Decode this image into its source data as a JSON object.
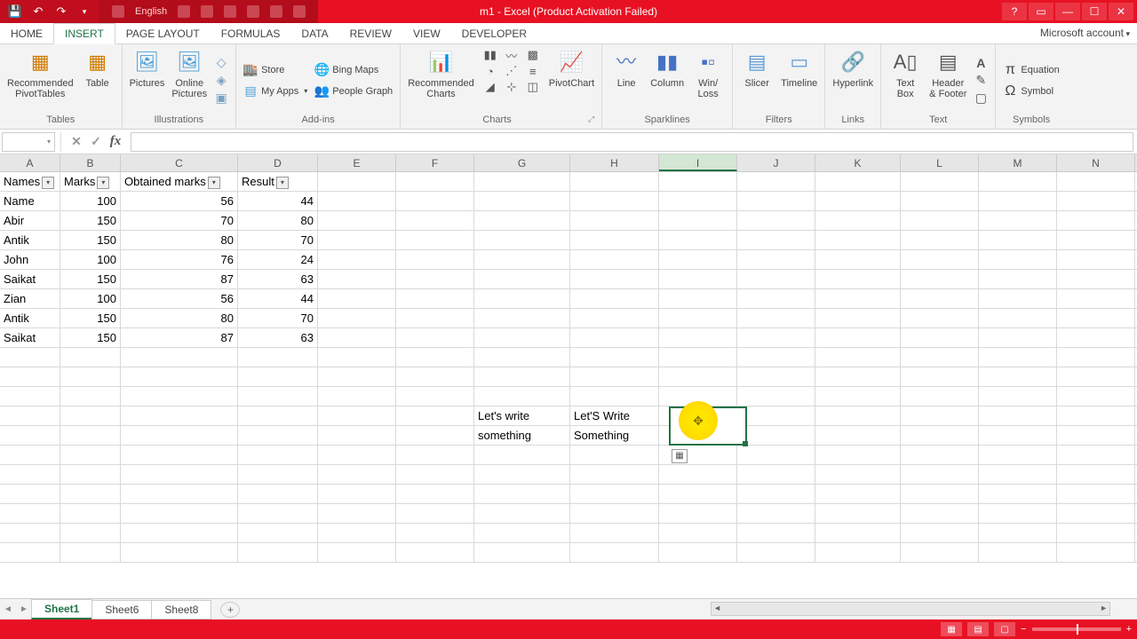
{
  "title": "m1 - Excel (Product Activation Failed)",
  "language": "English",
  "account_label": "Microsoft account",
  "tabs": {
    "home": "HOME",
    "insert": "INSERT",
    "page_layout": "PAGE LAYOUT",
    "formulas": "FORMULAS",
    "data": "DATA",
    "review": "REVIEW",
    "view": "VIEW",
    "developer": "DEVELOPER"
  },
  "ribbon": {
    "tables": {
      "label": "Tables",
      "table": "Table",
      "pivot": "Recommended\nPivotTables"
    },
    "illustrations": {
      "label": "Illustrations",
      "pictures": "Pictures",
      "online": "Online\nPictures"
    },
    "addins": {
      "label": "Add-ins",
      "store": "Store",
      "bing": "Bing Maps",
      "myapps": "My Apps",
      "people": "People Graph"
    },
    "charts": {
      "label": "Charts",
      "rec": "Recommended\nCharts",
      "pivotchart": "PivotChart"
    },
    "sparklines": {
      "label": "Sparklines",
      "line": "Line",
      "column": "Column",
      "winloss": "Win/\nLoss"
    },
    "filters": {
      "label": "Filters",
      "slicer": "Slicer",
      "timeline": "Timeline"
    },
    "links": {
      "label": "Links",
      "hyperlink": "Hyperlink"
    },
    "text": {
      "label": "Text",
      "textbox": "Text\nBox",
      "header": "Header\n& Footer"
    },
    "symbols": {
      "label": "Symbols",
      "equation": "Equation",
      "symbol": "Symbol"
    }
  },
  "name_box": "",
  "formula_value": "",
  "columns": [
    "A",
    "B",
    "C",
    "D",
    "E",
    "F",
    "G",
    "H",
    "I",
    "J",
    "K",
    "L",
    "M",
    "N"
  ],
  "active_column": "I",
  "table_headers": {
    "a": "Names",
    "b": "Marks",
    "c": "Obtained marks",
    "d": "Result"
  },
  "rows": [
    {
      "name": "Name",
      "marks": 100,
      "obtained": 56,
      "result": 44
    },
    {
      "name": "Abir",
      "marks": 150,
      "obtained": 70,
      "result": 80
    },
    {
      "name": "Antik",
      "marks": 150,
      "obtained": 80,
      "result": 70
    },
    {
      "name": "John",
      "marks": 100,
      "obtained": 76,
      "result": 24
    },
    {
      "name": "Saikat",
      "marks": 150,
      "obtained": 87,
      "result": 63
    },
    {
      "name": "Zian",
      "marks": 100,
      "obtained": 56,
      "result": 44
    },
    {
      "name": "Antik",
      "marks": 150,
      "obtained": 80,
      "result": 70
    },
    {
      "name": "Saikat",
      "marks": 150,
      "obtained": 87,
      "result": 63
    }
  ],
  "text_cells": {
    "g13": "Let's write",
    "g14": "something",
    "h13": "Let'S Write",
    "h14": "Something"
  },
  "sheets": {
    "active": "Sheet1",
    "s2": "Sheet6",
    "s3": "Sheet8"
  },
  "status_mode": "",
  "zoom": "100%"
}
